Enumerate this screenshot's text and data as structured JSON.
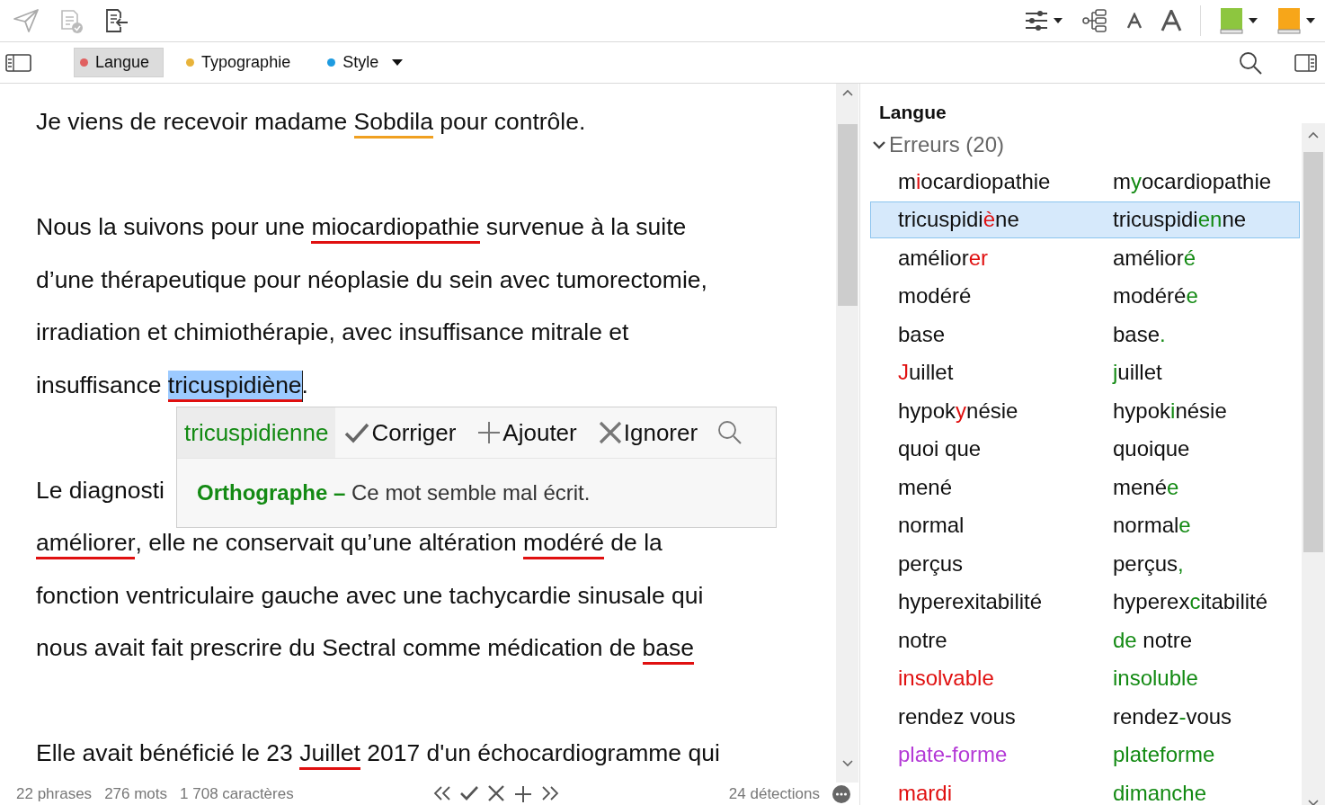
{
  "filter_tabs": [
    {
      "label": "Langue",
      "color": "#e06060",
      "selected": true,
      "dropdown": false
    },
    {
      "label": "Typographie",
      "color": "#e8b33a",
      "selected": false,
      "dropdown": false
    },
    {
      "label": "Style",
      "color": "#1e9be0",
      "selected": false,
      "dropdown": true
    }
  ],
  "document": {
    "lines": [
      {
        "segments": [
          {
            "kind": "text",
            "text": "Je viens de recevoir madame "
          },
          {
            "kind": "error",
            "text": "Sobdila",
            "color": "#f0a020",
            "selected": false
          },
          {
            "kind": "text",
            "text": " pour contrôle."
          }
        ]
      },
      {
        "kind": "blank"
      },
      {
        "segments": [
          {
            "kind": "text",
            "text": "Nous la suivons pour une "
          },
          {
            "kind": "error",
            "text": "miocardiopathie",
            "color": "#e01010",
            "selected": false
          },
          {
            "kind": "text",
            "text": " survenue à la suite"
          }
        ]
      },
      {
        "segments": [
          {
            "kind": "text",
            "text": "d’une thérapeutique pour néoplasie du sein avec tumorectomie,"
          }
        ]
      },
      {
        "segments": [
          {
            "kind": "text",
            "text": "irradiation et chimiothérapie, avec insuffisance mitrale et"
          }
        ]
      },
      {
        "segments": [
          {
            "kind": "text",
            "text": "insuffisance "
          },
          {
            "kind": "error",
            "text": "tricuspidiène",
            "color": "#e01010",
            "selected": true
          },
          {
            "kind": "text",
            "text": "."
          }
        ]
      },
      {
        "kind": "blank"
      },
      {
        "segments": [
          {
            "kind": "text",
            "text": "Le diagnosti"
          }
        ]
      },
      {
        "segments": [
          {
            "kind": "error",
            "text": "améliorer",
            "color": "#e01010",
            "selected": false
          },
          {
            "kind": "text",
            "text": ", elle ne conservait qu’une altération "
          },
          {
            "kind": "error",
            "text": "modéré",
            "color": "#e01010",
            "selected": false
          },
          {
            "kind": "text",
            "text": " de la"
          }
        ]
      },
      {
        "segments": [
          {
            "kind": "text",
            "text": "fonction ventriculaire gauche avec une tachycardie sinusale qui"
          }
        ]
      },
      {
        "segments": [
          {
            "kind": "text",
            "text": "nous avait fait prescrire du Sectral comme médication de "
          },
          {
            "kind": "error",
            "text": "base",
            "color": "#e01010",
            "selected": false
          }
        ]
      },
      {
        "kind": "blank"
      },
      {
        "segments": [
          {
            "kind": "text",
            "text": "Elle avait bénéficié le 23 "
          },
          {
            "kind": "error",
            "text": "Juillet",
            "color": "#e01010",
            "selected": false
          },
          {
            "kind": "text",
            "text": " 2017 d'un échocardiogramme qui"
          }
        ]
      }
    ]
  },
  "popup": {
    "suggestion": "tricuspidienne",
    "actions": [
      {
        "label": "Corriger",
        "kind": "check"
      },
      {
        "label": "Ajouter",
        "kind": "plus"
      },
      {
        "label": "Ignorer",
        "kind": "cross"
      }
    ],
    "message": "**Orthographe –** Ce mot semble mal écrit."
  },
  "status_bar": {
    "sentences": "22 phrases",
    "words": "276 mots",
    "characters": "1 708 caractères",
    "detections": "24 détections"
  },
  "panel": {
    "title": "Langue",
    "group": {
      "label": "Erreurs (20)",
      "expanded": true,
      "rows": [
        {
          "selected": false,
          "original": [
            {
              "text": "m",
              "kind": "plain"
            },
            {
              "text": "i",
              "kind": "wrong"
            },
            {
              "text": "ocardiopathie",
              "kind": "plain"
            }
          ],
          "correction": [
            {
              "text": "m",
              "kind": "plain"
            },
            {
              "text": "y",
              "kind": "fix"
            },
            {
              "text": "ocardiopathie",
              "kind": "plain"
            }
          ]
        },
        {
          "selected": true,
          "original": [
            {
              "text": "tricuspidi",
              "kind": "plain"
            },
            {
              "text": "è",
              "kind": "wrong"
            },
            {
              "text": "ne",
              "kind": "plain"
            }
          ],
          "correction": [
            {
              "text": "tricuspidi",
              "kind": "plain"
            },
            {
              "text": "en",
              "kind": "fix"
            },
            {
              "text": "ne",
              "kind": "plain"
            }
          ]
        },
        {
          "selected": false,
          "original": [
            {
              "text": "amélior",
              "kind": "plain"
            },
            {
              "text": "er",
              "kind": "wrong"
            }
          ],
          "correction": [
            {
              "text": "amélior",
              "kind": "plain"
            },
            {
              "text": "é",
              "kind": "fix"
            }
          ]
        },
        {
          "selected": false,
          "original": [
            {
              "text": "modéré",
              "kind": "plain"
            }
          ],
          "correction": [
            {
              "text": "modéré",
              "kind": "plain"
            },
            {
              "text": "e",
              "kind": "fix"
            }
          ]
        },
        {
          "selected": false,
          "original": [
            {
              "text": "base",
              "kind": "plain"
            }
          ],
          "correction": [
            {
              "text": "base",
              "kind": "plain"
            },
            {
              "text": ".",
              "kind": "fix"
            }
          ]
        },
        {
          "selected": false,
          "original": [
            {
              "text": "J",
              "kind": "wrong"
            },
            {
              "text": "uillet",
              "kind": "plain"
            }
          ],
          "correction": [
            {
              "text": "j",
              "kind": "fix"
            },
            {
              "text": "uillet",
              "kind": "plain"
            }
          ]
        },
        {
          "selected": false,
          "original": [
            {
              "text": "hypok",
              "kind": "plain"
            },
            {
              "text": "y",
              "kind": "wrong"
            },
            {
              "text": "nésie",
              "kind": "plain"
            }
          ],
          "correction": [
            {
              "text": "hypok",
              "kind": "plain"
            },
            {
              "text": "i",
              "kind": "fix"
            },
            {
              "text": "nésie",
              "kind": "plain"
            }
          ]
        },
        {
          "selected": false,
          "original": [
            {
              "text": "quoi que",
              "kind": "plain"
            }
          ],
          "correction": [
            {
              "text": "quoique",
              "kind": "plain"
            }
          ]
        },
        {
          "selected": false,
          "original": [
            {
              "text": "mené",
              "kind": "plain"
            }
          ],
          "correction": [
            {
              "text": "mené",
              "kind": "plain"
            },
            {
              "text": "e",
              "kind": "fix"
            }
          ]
        },
        {
          "selected": false,
          "original": [
            {
              "text": "normal",
              "kind": "plain"
            }
          ],
          "correction": [
            {
              "text": "normal",
              "kind": "plain"
            },
            {
              "text": "e",
              "kind": "fix"
            }
          ]
        },
        {
          "selected": false,
          "original": [
            {
              "text": "perçus",
              "kind": "plain"
            }
          ],
          "correction": [
            {
              "text": "perçus",
              "kind": "plain"
            },
            {
              "text": ",",
              "kind": "fix"
            }
          ]
        },
        {
          "selected": false,
          "original": [
            {
              "text": "hyperexitabilité",
              "kind": "plain"
            }
          ],
          "correction": [
            {
              "text": "hyperex",
              "kind": "plain"
            },
            {
              "text": "c",
              "kind": "fix"
            },
            {
              "text": "itabilité",
              "kind": "plain"
            }
          ]
        },
        {
          "selected": false,
          "original": [
            {
              "text": "notre",
              "kind": "plain"
            }
          ],
          "correction": [
            {
              "text": "de",
              "kind": "fix"
            },
            {
              "text": " notre",
              "kind": "plain"
            }
          ]
        },
        {
          "selected": false,
          "original": [
            {
              "text": "insolvable",
              "kind": "wrong"
            }
          ],
          "correction": [
            {
              "text": "insoluble",
              "kind": "fix"
            }
          ]
        },
        {
          "selected": false,
          "original": [
            {
              "text": "rendez vous",
              "kind": "plain"
            }
          ],
          "correction": [
            {
              "text": "rendez",
              "kind": "plain"
            },
            {
              "text": "-",
              "kind": "fix"
            },
            {
              "text": "vous",
              "kind": "plain"
            }
          ]
        },
        {
          "selected": false,
          "original": [
            {
              "text": "plate-forme",
              "kind": "style"
            }
          ],
          "correction": [
            {
              "text": "plateforme",
              "kind": "fix"
            }
          ]
        },
        {
          "selected": false,
          "original": [
            {
              "text": "mardi",
              "kind": "wrong"
            }
          ],
          "correction": [
            {
              "text": "dimanche",
              "kind": "fix"
            }
          ]
        }
      ]
    }
  }
}
